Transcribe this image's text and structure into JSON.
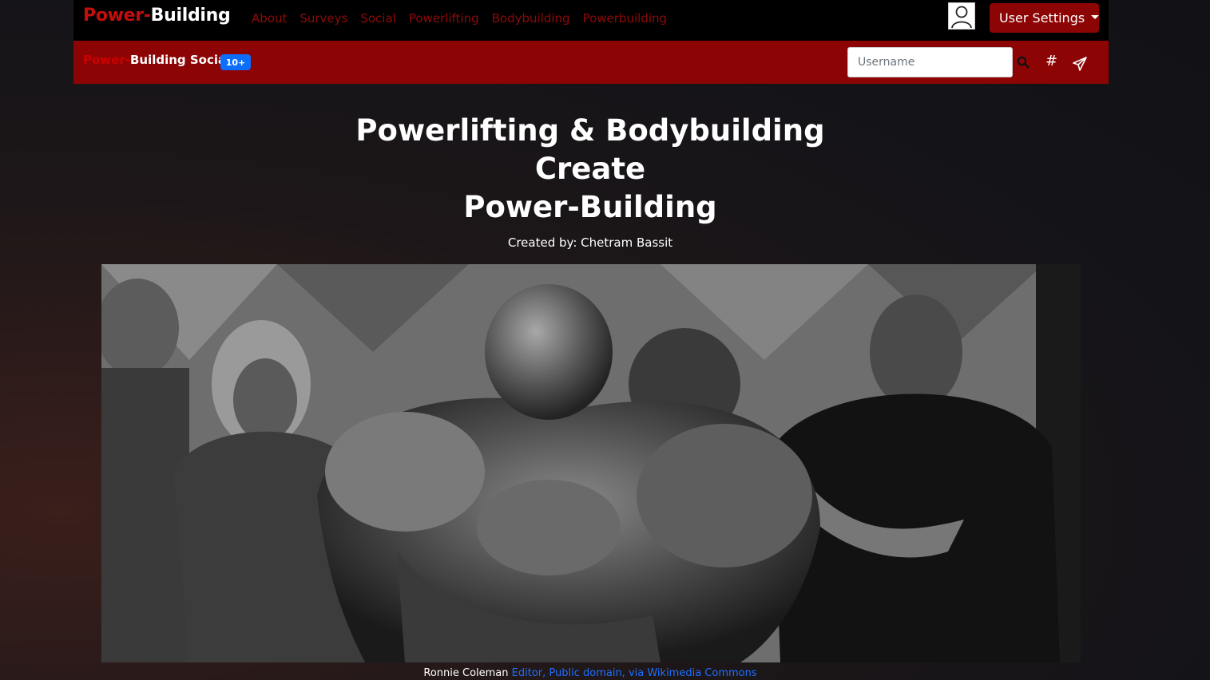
{
  "navbar": {
    "brand_part1": "Power-",
    "brand_part2": "Building",
    "links": [
      "About",
      "Surveys",
      "Social",
      "Powerlifting",
      "Bodybuilding",
      "Powerbuilding"
    ],
    "user_settings_label": "User Settings",
    "avatar_icon": "user-icon"
  },
  "social_bar": {
    "brand_part1": "Power-",
    "brand_part2": "Building Social",
    "badge": "10+",
    "search_placeholder": "Username",
    "search_icon": "search-icon",
    "hashtag_label": "#",
    "send_icon": "send-icon"
  },
  "hero": {
    "title_line1": "Powerlifting & Bodybuilding",
    "title_line2": "Create",
    "title_line3": "Power-Building",
    "credit": "Created by: Chetram Bassit"
  },
  "image_caption": {
    "subject": "Ronnie Coleman",
    "attribution": "Editor, Public domain, via Wikimedia Commons"
  },
  "colors": {
    "accent_red": "#8c0404",
    "brand_red": "#c40d0d",
    "badge_blue": "#0d6efd",
    "link_blue": "#1e6fff"
  }
}
